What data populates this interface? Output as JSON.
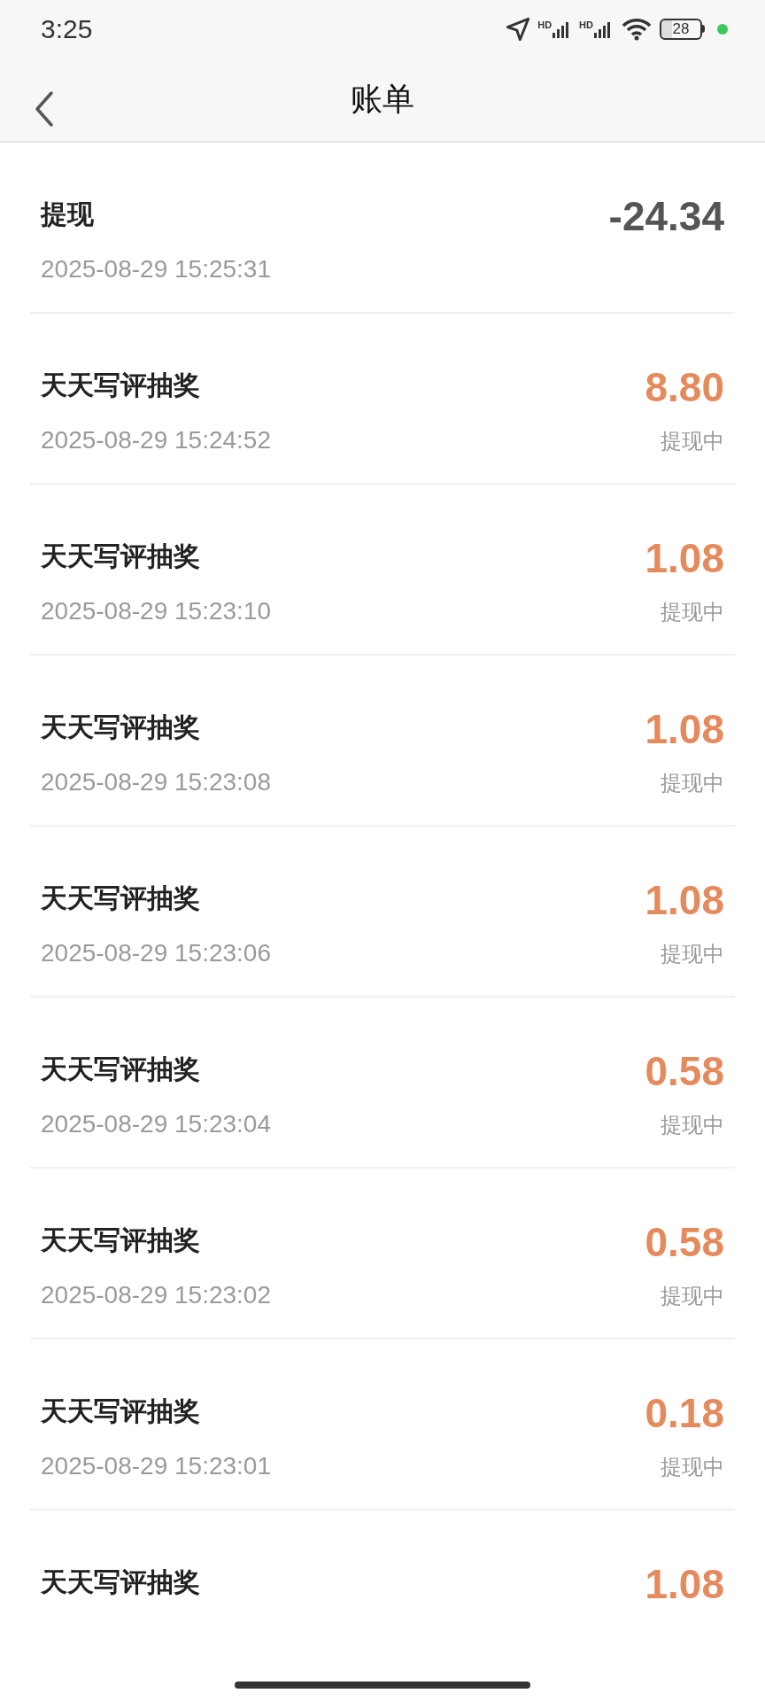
{
  "status_bar": {
    "time": "3:25",
    "signal_labels": [
      "HD",
      "HD"
    ],
    "battery": "28"
  },
  "header": {
    "title": "账单"
  },
  "bills": [
    {
      "kind": "withdrawal",
      "title": "提现",
      "time": "2025-08-29 15:25:31",
      "amount": "-24.34"
    },
    {
      "kind": "income",
      "title": "天天写评抽奖",
      "time": "2025-08-29 15:24:52",
      "amount": "8.80",
      "status": "提现中"
    },
    {
      "kind": "income",
      "title": "天天写评抽奖",
      "time": "2025-08-29 15:23:10",
      "amount": "1.08",
      "status": "提现中"
    },
    {
      "kind": "income",
      "title": "天天写评抽奖",
      "time": "2025-08-29 15:23:08",
      "amount": "1.08",
      "status": "提现中"
    },
    {
      "kind": "income",
      "title": "天天写评抽奖",
      "time": "2025-08-29 15:23:06",
      "amount": "1.08",
      "status": "提现中"
    },
    {
      "kind": "income",
      "title": "天天写评抽奖",
      "time": "2025-08-29 15:23:04",
      "amount": "0.58",
      "status": "提现中"
    },
    {
      "kind": "income",
      "title": "天天写评抽奖",
      "time": "2025-08-29 15:23:02",
      "amount": "0.58",
      "status": "提现中"
    },
    {
      "kind": "income",
      "title": "天天写评抽奖",
      "time": "2025-08-29 15:23:01",
      "amount": "0.18",
      "status": "提现中"
    },
    {
      "kind": "income",
      "title": "天天写评抽奖",
      "amount": "1.08"
    }
  ]
}
